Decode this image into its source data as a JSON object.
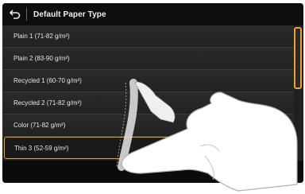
{
  "header": {
    "title": "Default Paper Type",
    "back_icon": "back-arrow-icon"
  },
  "paper_types": [
    {
      "label": "Plain 1 (71-82 g/m²)",
      "selected": false
    },
    {
      "label": "Plain 2 (83-90 g/m²)",
      "selected": false
    },
    {
      "label": "Recycled 1 (60-70 g/m²)",
      "selected": false
    },
    {
      "label": "Recycled 2 (71-82 g/m²)",
      "selected": false
    },
    {
      "label": "Color (71-82 g/m²)",
      "selected": false
    },
    {
      "label": "Thin 3 (52-59 g/m²)",
      "selected": true
    }
  ],
  "colors": {
    "accent": "#f0a12b",
    "screen_bg": "#202020",
    "title_bg": "#0e0e0e"
  },
  "gesture_icon": "swipe-hand-icon"
}
